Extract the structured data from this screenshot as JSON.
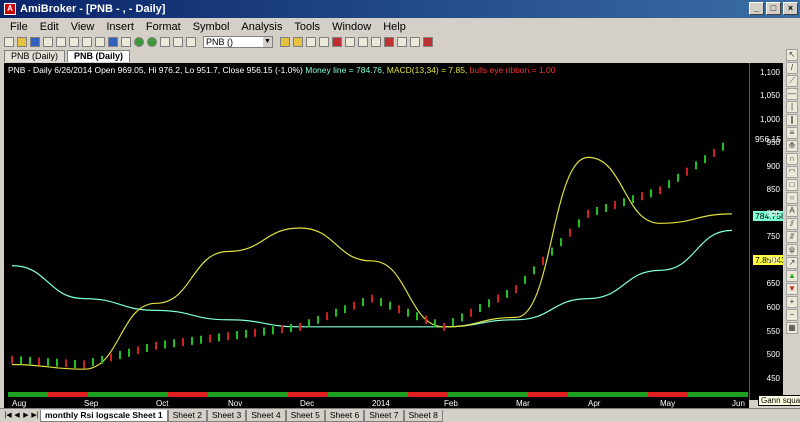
{
  "window": {
    "title": "AmiBroker - [PNB - , - Daily]",
    "controls": [
      "_",
      "□",
      "×"
    ]
  },
  "menu": [
    "File",
    "Edit",
    "View",
    "Insert",
    "Format",
    "Symbol",
    "Analysis",
    "Tools",
    "Window",
    "Help"
  ],
  "toolbar": {
    "symbol_value": "PNB ()"
  },
  "doc_tabs": [
    {
      "label": "PNB (Daily)",
      "active": false
    },
    {
      "label": "PNB (Daily)",
      "active": true
    }
  ],
  "chart_info": {
    "prefix": "PNB - Daily 6/26/2014 Open 969.05, Hi 976.2, Lo 951.7, Close 956.15 (-1.0%)",
    "money_line": "Money line = 784.76,",
    "macd": "MACD(13,34) = 7.85,",
    "ribbon": "bulls eye ribbon = 1.00"
  },
  "price_badges": {
    "close": "956.15",
    "money_line": "784.758",
    "macd": "7.85043"
  },
  "colors": {
    "candle_up": "#20c020",
    "candle_down": "#d02020",
    "money_line": "#7fffd4",
    "macd_line": "#e0e040",
    "ribbon_up": "#20a020",
    "ribbon_down": "#e02020"
  },
  "chart_data": {
    "type": "line",
    "y_ticks": [
      1100,
      1050,
      1000,
      950,
      900,
      850,
      800,
      750,
      700,
      650,
      600,
      550,
      500,
      450
    ],
    "x_ticks": [
      "Aug",
      "Sep",
      "Oct",
      "Nov",
      "Dec",
      "2014",
      "Feb",
      "Mar",
      "Apr",
      "May",
      "Jun"
    ],
    "ylim": [
      430,
      1110
    ],
    "x": [
      "Aug",
      "Sep",
      "Oct",
      "Nov",
      "Dec",
      "2014",
      "Feb",
      "Mar",
      "Apr",
      "May",
      "Jun"
    ],
    "series": [
      {
        "name": "Money line",
        "values": [
          690,
          620,
          595,
          575,
          560,
          560,
          560,
          575,
          620,
          680,
          765
        ]
      },
      {
        "name": "MACD(13,34)",
        "values": [
          480,
          470,
          610,
          720,
          770,
          700,
          560,
          580,
          920,
          780,
          800
        ]
      },
      {
        "name": "Close",
        "values": [
          490,
          480,
          520,
          540,
          560,
          620,
          560,
          640,
          800,
          850,
          956
        ]
      }
    ]
  },
  "sheets": [
    {
      "label": "monthly Rsi logscale Sheet 1",
      "active": true
    },
    {
      "label": "Sheet 2",
      "active": false
    },
    {
      "label": "Sheet 3",
      "active": false
    },
    {
      "label": "Sheet 4",
      "active": false
    },
    {
      "label": "Sheet 5",
      "active": false
    },
    {
      "label": "Sheet 6",
      "active": false
    },
    {
      "label": "Sheet 7",
      "active": false
    },
    {
      "label": "Sheet 8",
      "active": false
    }
  ],
  "tooltip": "Gann square"
}
